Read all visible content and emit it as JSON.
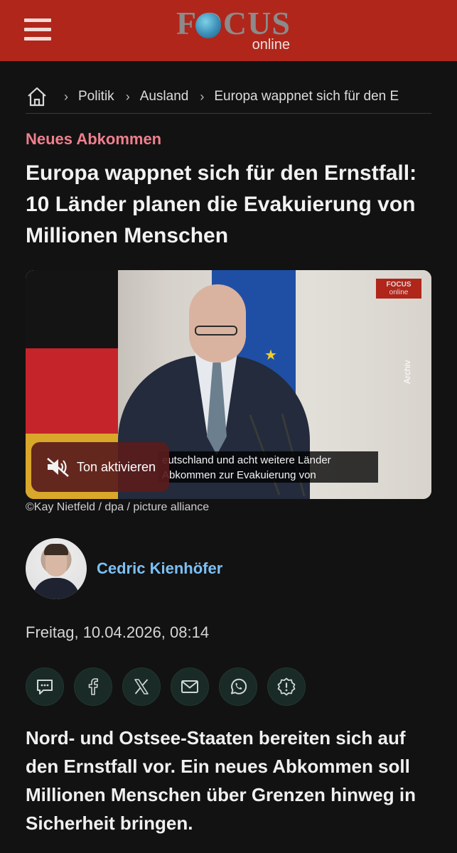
{
  "header": {
    "logo_word": "FOCUS",
    "logo_sub": "online",
    "menu_icon": "hamburger-icon"
  },
  "breadcrumb": {
    "home_icon": "home-icon",
    "items": [
      "Politik",
      "Ausland",
      "Europa wappnet sich für den E"
    ]
  },
  "article": {
    "kicker": "Neues Abkommen",
    "headline": "Europa wappnet sich für den Ernstfall: 10 Länder planen die Evakuierung von Millionen Menschen",
    "media": {
      "subtitle_line1": "eutschland und acht weitere Länder",
      "subtitle_line2": "Abkommen zur Evakuierung von",
      "watermark_word": "FOCUS",
      "watermark_sub": "online",
      "archive_label": "Archiv",
      "sound_button_label": "Ton aktivieren",
      "sound_icon": "speaker-muted-icon"
    },
    "credit": "©Kay Nietfeld / dpa / picture alliance",
    "author": "Cedric Kienhöfer",
    "date": "Freitag, 10.04.2026, 08:14",
    "share_icons": [
      "comment-icon",
      "facebook-icon",
      "x-icon",
      "mail-icon",
      "whatsapp-icon",
      "report-icon"
    ],
    "lead": "Nord- und Ostsee-Staaten bereiten sich auf den Ernstfall vor. Ein neues Abkommen soll Millionen Menschen über Grenzen hinweg in Sicherheit bringen."
  },
  "colors": {
    "header_bg": "#b0261b",
    "page_bg": "#121212",
    "kicker": "#f07f8e",
    "author_link": "#7cc0f5"
  }
}
